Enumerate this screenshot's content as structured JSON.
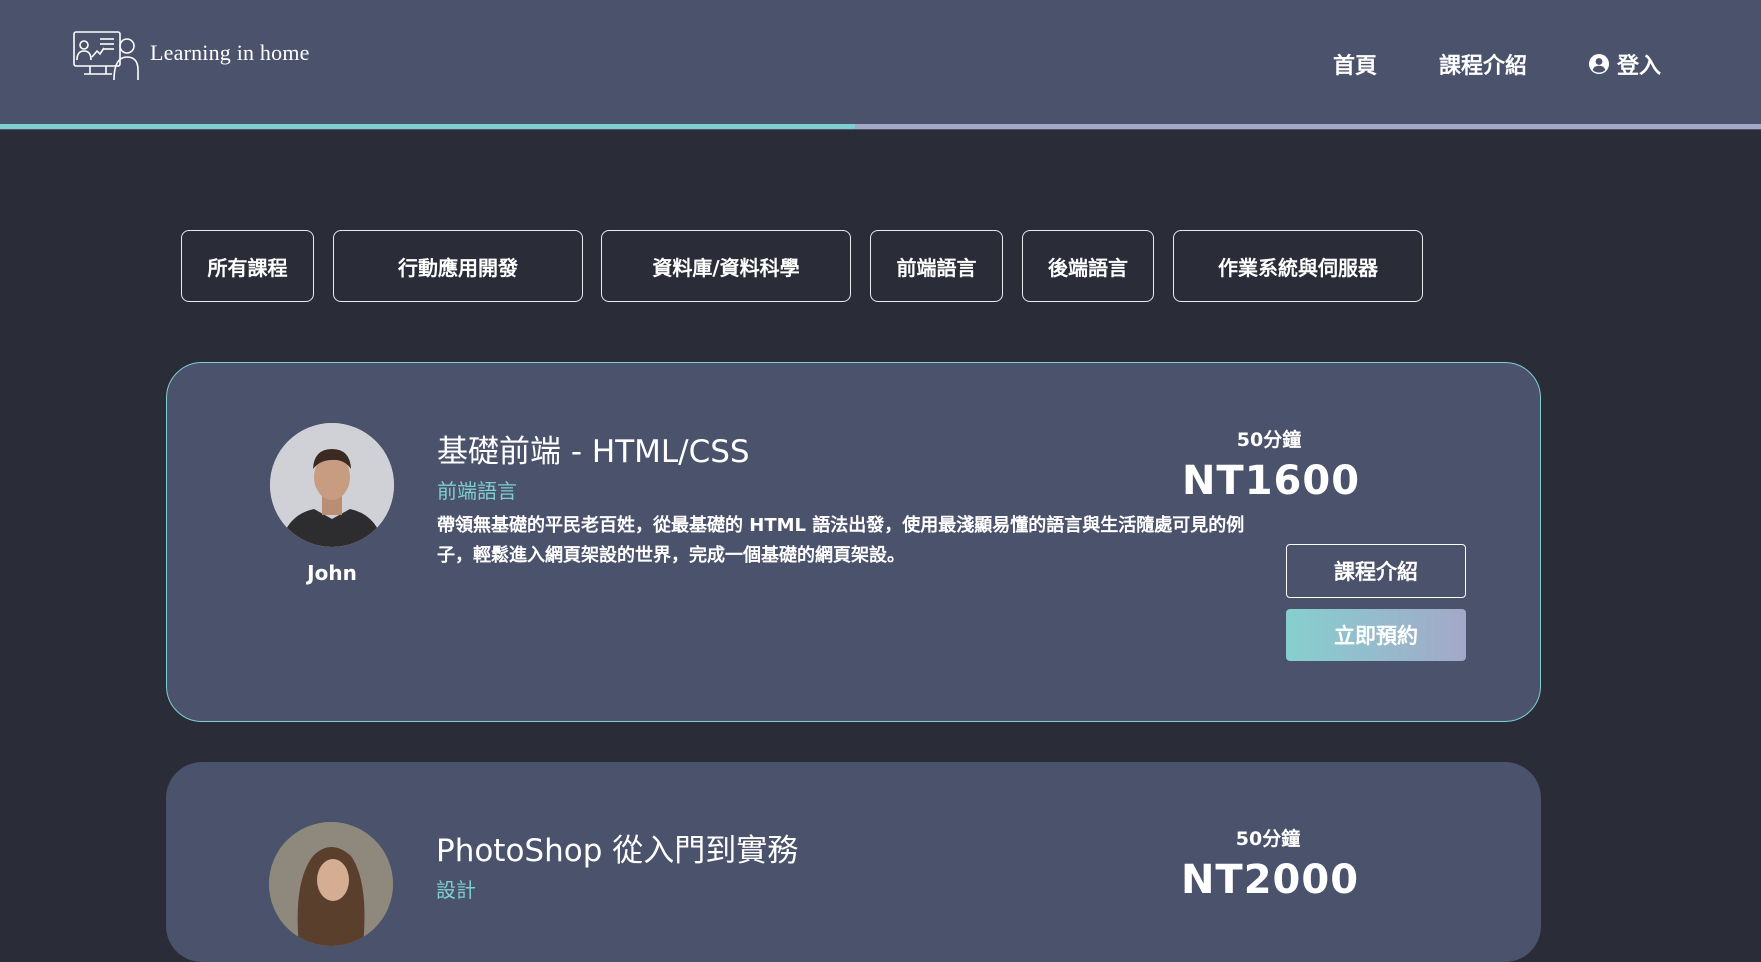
{
  "header": {
    "logo_text": "Learning in home",
    "nav": {
      "home": "首頁",
      "courses": "課程介紹",
      "login": "登入"
    }
  },
  "filters": [
    "所有課程",
    "行動應用開發",
    "資料庫/資料科學",
    "前端語言",
    "後端語言",
    "作業系統與伺服器"
  ],
  "courses": [
    {
      "teacher": "John",
      "title": "基礎前端 - HTML/CSS",
      "category": "前端語言",
      "description": "帶領無基礎的平民老百姓，從最基礎的 HTML 語法出發，使用最淺顯易懂的語言與生活隨處可見的例子，輕鬆進入網頁架設的世界，完成一個基礎的網頁架設。",
      "duration": "50分鐘",
      "price": "NT1600",
      "intro_button": "課程介紹",
      "book_button": "立即預約"
    },
    {
      "title": "PhotoShop 從入門到實務",
      "category": "設計",
      "duration": "50分鐘",
      "price": "NT2000"
    }
  ],
  "colors": {
    "background": "#2a2d38",
    "header": "#4b526b",
    "card": "#4b526b",
    "accent_teal": "#7ecfcf",
    "accent_lilac": "#a5a8c6"
  }
}
